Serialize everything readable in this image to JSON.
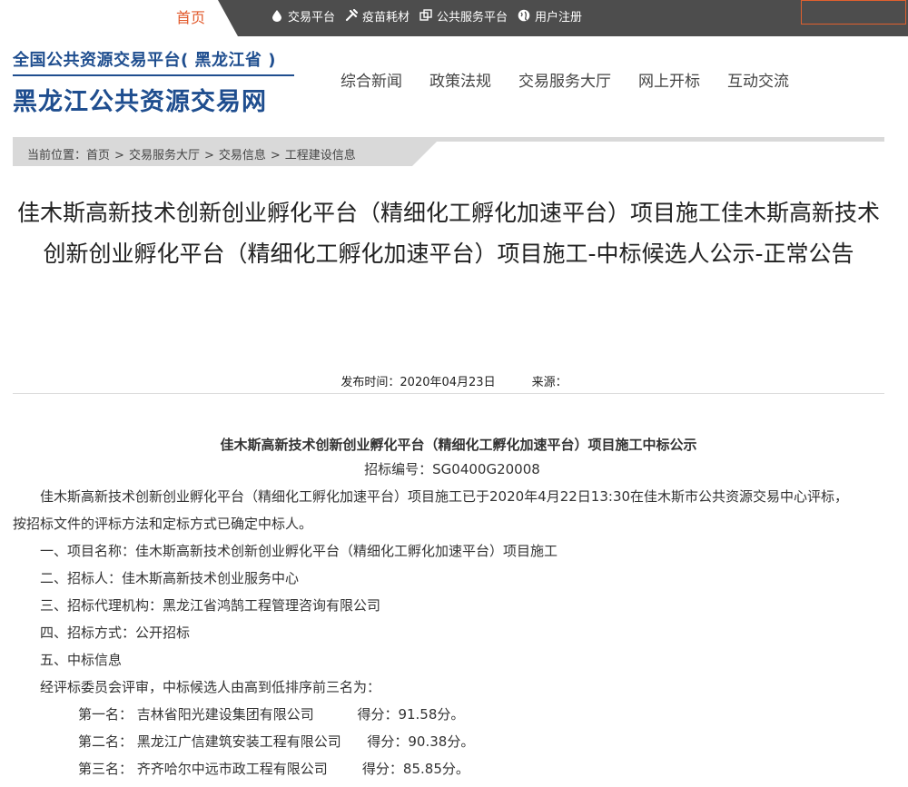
{
  "topbar": {
    "home": "首页",
    "links": [
      {
        "label": "交易平台",
        "icon": "drop-icon"
      },
      {
        "label": "疫苗耗材",
        "icon": "syringe-icon"
      },
      {
        "label": "公共服务平台",
        "icon": "windows-icon"
      },
      {
        "label": "用户注册",
        "icon": "globe-icon"
      }
    ]
  },
  "logo": {
    "subtitle": "全国公共资源交易平台( 黑龙江省 )",
    "title": "黑龙江公共资源交易网"
  },
  "nav": [
    "综合新闻",
    "政策法规",
    "交易服务大厅",
    "网上开标",
    "互动交流"
  ],
  "breadcrumb": {
    "prefix": "当前位置：",
    "items": [
      "首页",
      "交易服务大厅",
      "交易信息",
      "工程建设信息"
    ]
  },
  "title": "佳木斯高新技术创新创业孵化平台（精细化工孵化加速平台）项目施工佳木斯高新技术创新创业孵化平台（精细化工孵化加速平台）项目施工-中标候选人公示-正常公告",
  "meta": {
    "publish": "发布时间：2020年04月23日",
    "source": "来源："
  },
  "article": {
    "title": "佳木斯高新技术创新创业孵化平台（精细化工孵化加速平台）项目施工中标公示",
    "code": "招标编号：SG0400G20008",
    "intro": "佳木斯高新技术创新创业孵化平台（精细化工孵化加速平台）项目施工已于2020年4月22日13:30在佳木斯市公共资源交易中心评标，按招标文件的评标方法和定标方式已确定中标人。",
    "items": [
      "一、项目名称：佳木斯高新技术创新创业孵化平台（精细化工孵化加速平台）项目施工",
      "二、招标人：佳木斯高新技术创业服务中心",
      "三、招标代理机构：黑龙江省鸿鹄工程管理咨询有限公司",
      "四、招标方式：公开招标",
      "五、中标信息",
      "经评标委员会评审，中标候选人由高到低排序前三名为："
    ],
    "ranks": [
      "第一名： 吉林省阳光建设集团有限公司          得分：91.58分。",
      "第二名： 黑龙江广信建筑安装工程有限公司      得分：90.38分。",
      "第三名： 齐齐哈尔中远市政工程有限公司        得分：85.85分。"
    ]
  }
}
